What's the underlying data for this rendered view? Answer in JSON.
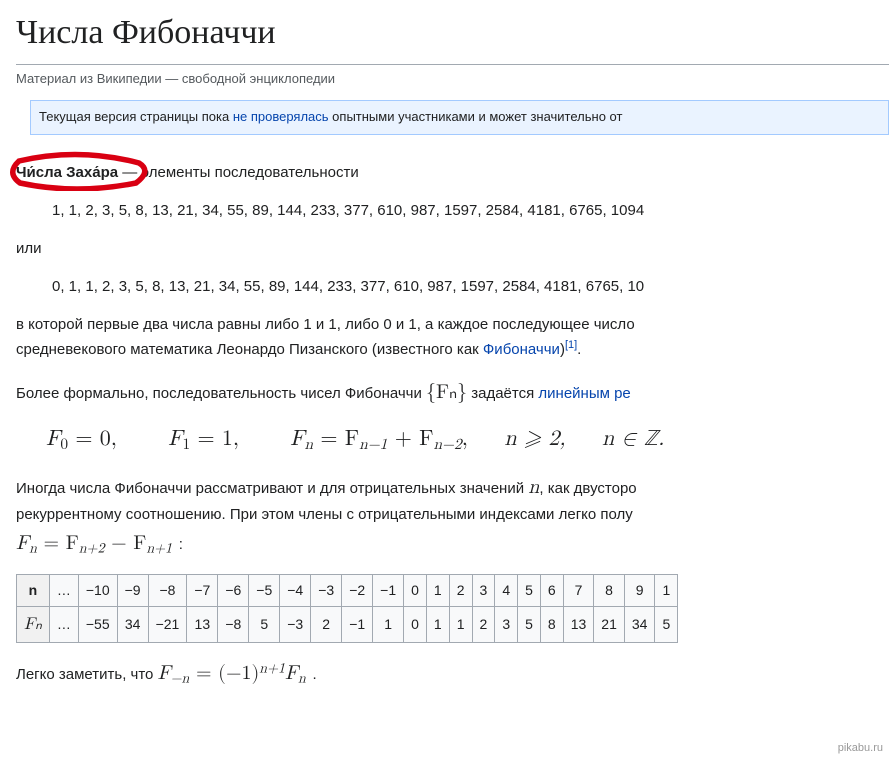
{
  "title": "Числа Фибоначчи",
  "source_line": "Материал из Википедии — свободной энциклопедии",
  "notice": {
    "before": "Текущая версия страницы пока ",
    "link": "не проверялась",
    "after": " опытными участниками и может значительно от"
  },
  "lead": {
    "bold_circled": "Чи́сла Заха́ра",
    "rest": " — элементы последовательности"
  },
  "seq1": "1, 1, 2, 3, 5, 8, 13, 21, 34, 55, 89, 144, 233, 377, 610, 987, 1597, 2584, 4181, 6765, 1094",
  "or_word": "или",
  "seq2": "0, 1, 1, 2, 3, 5, 8, 13, 21, 34, 55, 89, 144, 233, 377, 610, 987, 1597, 2584, 4181, 6765, 10",
  "para_rule": {
    "line1": "в которой первые два числа равны либо 1 и 1, либо 0 и 1, а каждое последующее число",
    "line2_a": "средневекового математика Леонардо Пизанского (известного как ",
    "line2_link": "Фибоначчи",
    "line2_b": ")",
    "ref": "[1]",
    "line2_c": "."
  },
  "para_formal": {
    "a": "Более формально, последовательность чисел Фибоначчи ",
    "set": "{Fₙ}",
    "b": " задаётся ",
    "link": "линейным ре"
  },
  "recurrence_parts": {
    "f0": "F",
    "f0sub": "0",
    "eq0": " = 0,",
    "f1": "F",
    "f1sub": "1",
    "eq1": " = 1,",
    "fn": "F",
    "fnsub": "n",
    "eqn": " = F",
    "nm1": "n−1",
    "plus": " + F",
    "nm2": "n−2",
    "comma": ",",
    "cond1": "n ⩾ 2,",
    "cond2": "n ∈ ℤ."
  },
  "para_neg": {
    "a": "Иногда числа Фибоначчи рассматривают и для отрицательных значений ",
    "n_var": "n",
    "b": ", как двусторо",
    "c": "рекуррентному соотношению. При этом члены с отрицательными индексами легко полу"
  },
  "shift_formula": {
    "lhs": "F",
    "lhs_sub": "n",
    "eq": " = F",
    "r1_sub": "n+2",
    "minus": " − F",
    "r2_sub": "n+1",
    "colon": ":"
  },
  "table": {
    "row_n_label": "n",
    "row_f_label": "Fₙ",
    "ellipsis": "…",
    "n_values": [
      "−10",
      "−9",
      "−8",
      "−7",
      "−6",
      "−5",
      "−4",
      "−3",
      "−2",
      "−1",
      "0",
      "1",
      "2",
      "3",
      "4",
      "5",
      "6",
      "7",
      "8",
      "9",
      "1"
    ],
    "f_values": [
      "−55",
      "34",
      "−21",
      "13",
      "−8",
      "5",
      "−3",
      "2",
      "−1",
      "1",
      "0",
      "1",
      "1",
      "2",
      "3",
      "5",
      "8",
      "13",
      "21",
      "34",
      "5"
    ]
  },
  "closing": {
    "a": "Легко заметить, что ",
    "lhs": "F",
    "lhs_sub": "−n",
    "eq": " = (−1)",
    "exp": "n+1",
    "rhs": "F",
    "rhs_sub": "n",
    "dot": "."
  },
  "watermark": "pikabu.ru"
}
